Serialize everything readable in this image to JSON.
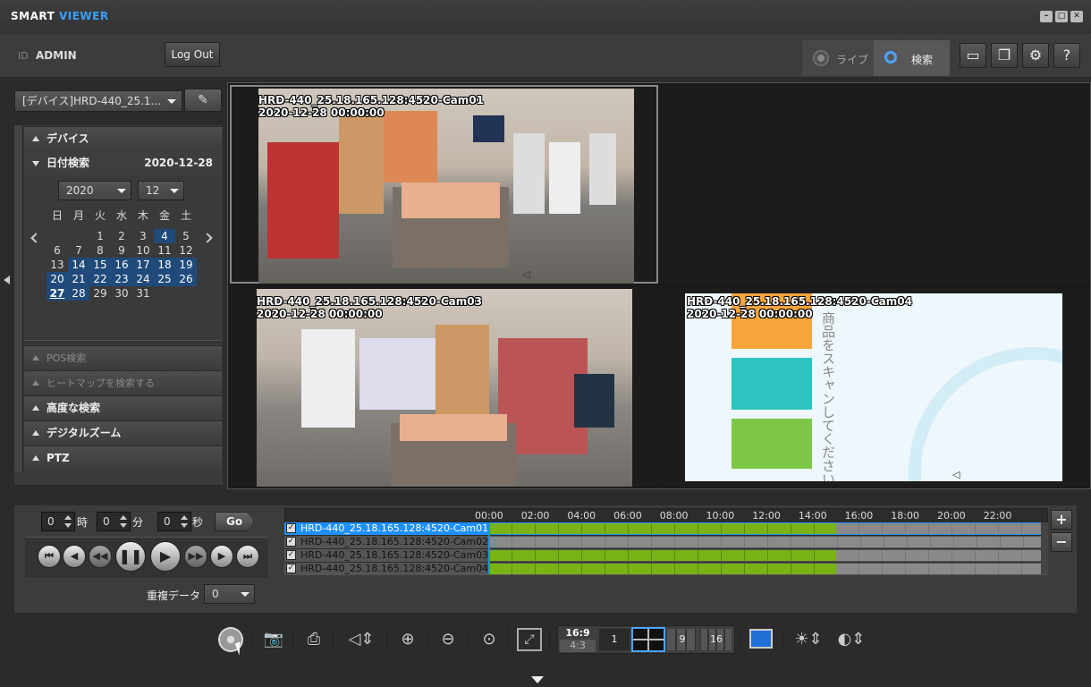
{
  "app": {
    "title_a": "SMART ",
    "title_b": "VIEWER"
  },
  "user": {
    "id_label": "ID",
    "name": "ADMIN",
    "logout": "Log Out"
  },
  "tabs": {
    "live": "ライブ",
    "search": "検索"
  },
  "device": {
    "value": "[デバイス]HRD-440_25.1..."
  },
  "sidebar": {
    "device_section": "デバイス",
    "date_section": "日付検索",
    "date_value": "2020-12-28",
    "year": "2020",
    "month": "12",
    "weekdays": [
      "日",
      "月",
      "火",
      "水",
      "木",
      "金",
      "土"
    ],
    "pos": "POS検索",
    "heatmap": "ヒートマップを検索する",
    "advanced": "高度な検索",
    "dzoom": "デジタルズーム",
    "ptz": "PTZ"
  },
  "cameras": [
    {
      "name": "HRD-440_25.18.165.128:4520-Cam01",
      "time": "2020-12-28 00:00:00"
    },
    {
      "name": "HRD-440_25.18.165.128:4520-Cam03",
      "time": "2020-12-28 00:00:00"
    },
    {
      "name": "HRD-440_25.18.165.128:4520-Cam04",
      "time": "2020-12-28 00:00:00"
    }
  ],
  "kiosk_text": "商品をスキャンしてください",
  "time_input": {
    "hour": "0",
    "hour_unit": "時",
    "min": "0",
    "min_unit": "分",
    "sec": "0",
    "sec_unit": "秒",
    "go": "Go"
  },
  "overlap": {
    "label": "重複データ",
    "value": "0"
  },
  "timeline": {
    "ticks": [
      "00:00",
      "02:00",
      "04:00",
      "06:00",
      "08:00",
      "10:00",
      "12:00",
      "14:00",
      "16:00",
      "18:00",
      "20:00",
      "22:00"
    ],
    "rows": [
      "HRD-440_25.18.165.128:4520-Cam01",
      "HRD-440_25.18.165.128:4520-Cam02",
      "HRD-440_25.18.165.128:4520-Cam03",
      "HRD-440_25.18.165.128:4520-Cam04"
    ]
  },
  "layout_buttons": {
    "ratio_a": "16:9",
    "ratio_b": "4:3",
    "one": "1",
    "nine": "9",
    "sixteen": "16"
  }
}
